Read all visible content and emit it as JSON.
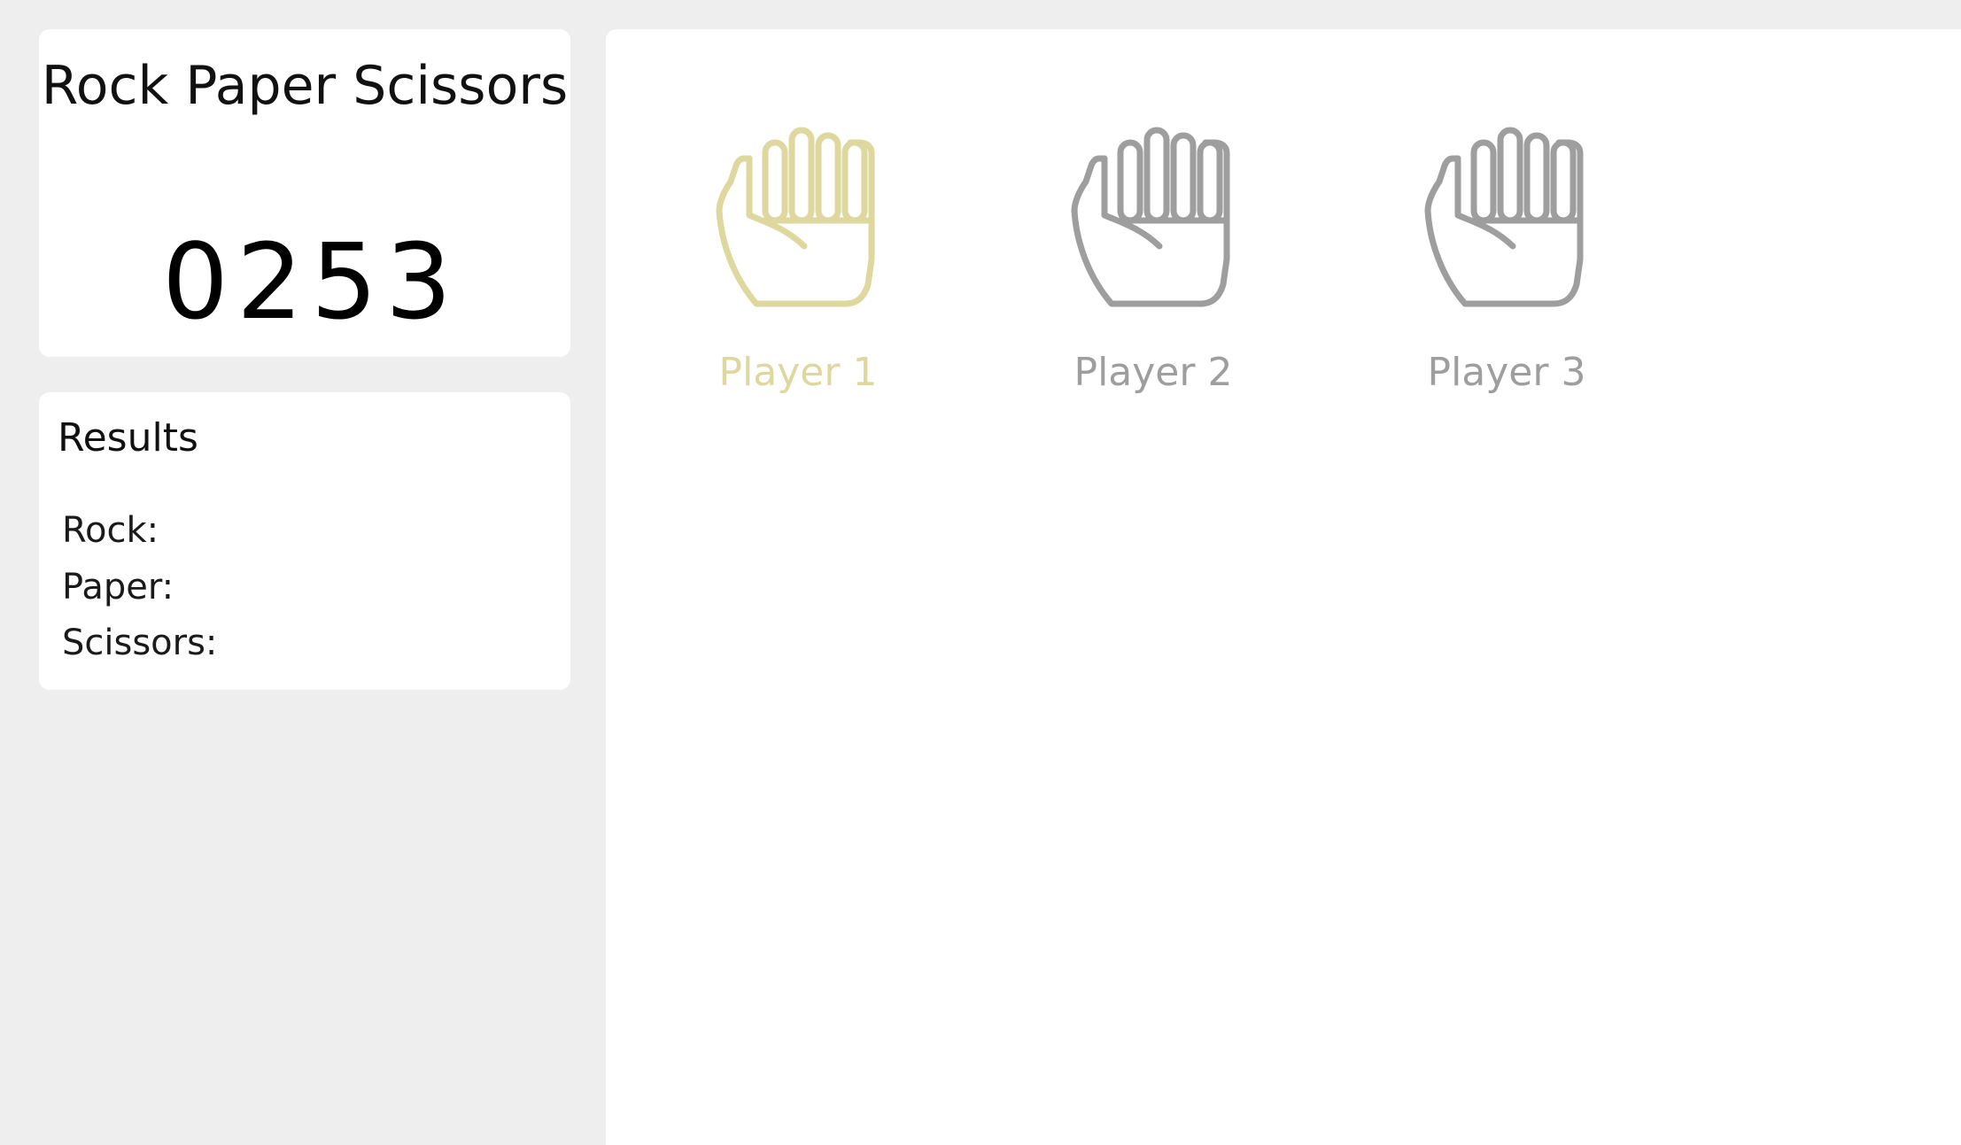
{
  "game": {
    "title": "Rock Paper Scissors",
    "score_digits": [
      "0",
      "2",
      "5",
      "3"
    ]
  },
  "results": {
    "title": "Results",
    "rock_label": "Rock:",
    "paper_label": "Paper:",
    "scissors_label": "Scissors:"
  },
  "players": [
    {
      "label": "Player 1",
      "icon": "fist-icon",
      "color": "#ded79e",
      "selected": true
    },
    {
      "label": "Player 2",
      "icon": "fist-icon",
      "color": "#9e9e9e",
      "selected": false
    },
    {
      "label": "Player 3",
      "icon": "fist-icon",
      "color": "#9e9e9e",
      "selected": false
    }
  ],
  "colors": {
    "background": "#eeeeee",
    "panel": "#ffffff",
    "active_player": "#ded79e",
    "inactive_player": "#9e9e9e"
  }
}
